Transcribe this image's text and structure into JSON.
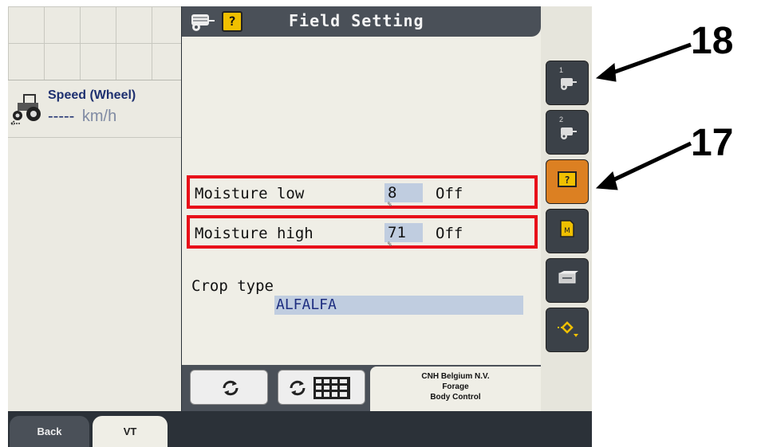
{
  "left_panel": {
    "speed_title": "Speed (Wheel)",
    "speed_value": "-----",
    "speed_unit": "km/h"
  },
  "main": {
    "title": "Field Setting",
    "help_icon_text": "?",
    "moisture_low": {
      "label": "Moisture low",
      "value": "8",
      "unit": "%",
      "state": "Off"
    },
    "moisture_high": {
      "label": "Moisture high",
      "value": "71",
      "unit": "%",
      "state": "Off"
    },
    "crop_type_label": "Crop type",
    "crop_type_value": "ALFALFA",
    "company": [
      "CNH Belgium N.V.",
      "Forage",
      "Body Control"
    ]
  },
  "right_keys": [
    {
      "number": "1",
      "icon": "baler-icon"
    },
    {
      "number": "2",
      "icon": "baler-icon"
    },
    {
      "number": "",
      "icon": "field-setting-icon",
      "active": true
    },
    {
      "number": "",
      "icon": "memo-icon"
    },
    {
      "number": "",
      "icon": "bale-icon"
    },
    {
      "number": "",
      "icon": "next-page-icon"
    }
  ],
  "tabs": {
    "back": "Back",
    "vt": "VT"
  },
  "annotations": {
    "label_top": "18",
    "label_bottom": "17"
  },
  "colors": {
    "highlight_border": "#e8101a",
    "active_key": "#dc8022",
    "value_field": "#c0cde0"
  }
}
